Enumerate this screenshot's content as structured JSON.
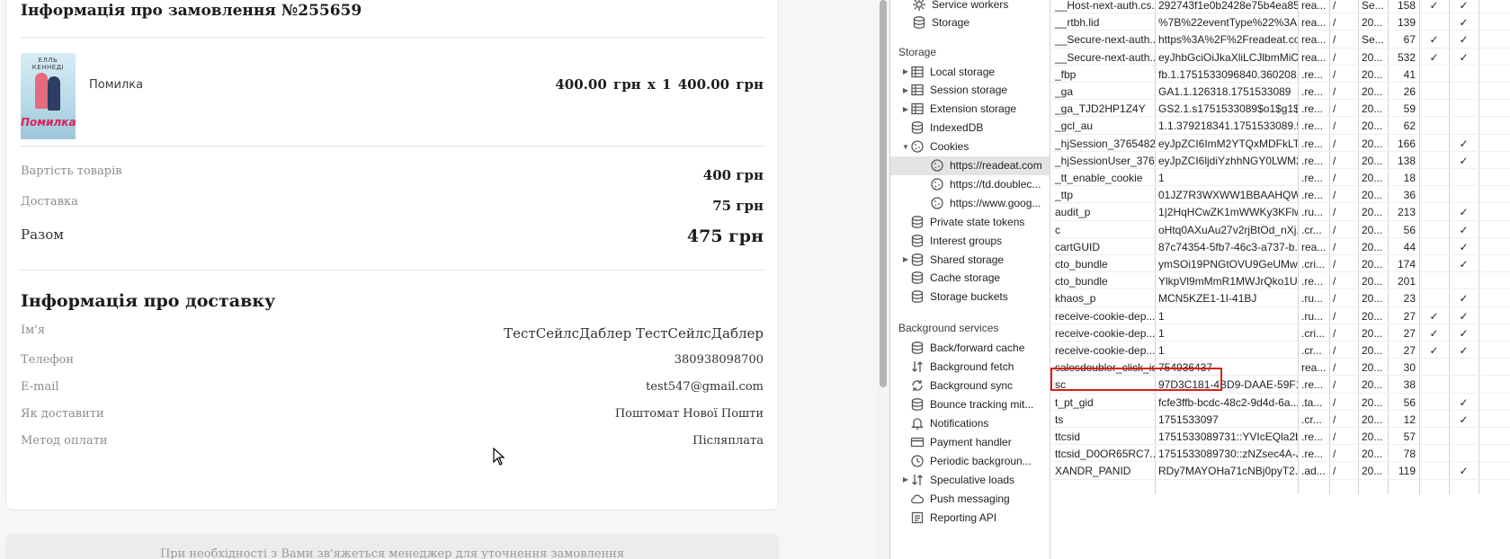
{
  "order": {
    "title": "Інформація про замовлення №255659",
    "product": {
      "cover_author": "ЕЛЛЬ КЕННЕДІ",
      "cover_title": "Помилка",
      "name": "Помилка",
      "price_line": "400.00 грн  x 1  400.00 грн"
    },
    "summary": {
      "goods_label": "Вартість товарів",
      "goods_value": "400 грн",
      "delivery_label": "Доставка",
      "delivery_value": "75 грн",
      "total_label": "Разом",
      "total_value": "475 грн"
    },
    "delivery_info": {
      "title": "Інформація про доставку",
      "name_label": "Ім'я",
      "name_value": "ТестСейлсДаблер ТестСейлсДаблер",
      "phone_label": "Телефон",
      "phone_value": "380938098700",
      "email_label": "E-mail",
      "email_value": "test547@gmail.com",
      "method_label": "Як доставити",
      "method_value": "Поштомат Нової Пошти",
      "payment_label": "Метод оплати",
      "payment_value": "Післяплата"
    },
    "manager_note": "При необхідності з Вами зв'яжеться менеджер для уточнення замовлення"
  },
  "devtools": {
    "tree_top": [
      {
        "label": "Service workers",
        "icon": "gear-icon"
      },
      {
        "label": "Storage",
        "icon": "database-icon"
      }
    ],
    "storage_header": "Storage",
    "storage_items": [
      {
        "label": "Local storage",
        "icon": "table-icon",
        "arrow": "▶"
      },
      {
        "label": "Session storage",
        "icon": "table-icon",
        "arrow": "▶"
      },
      {
        "label": "Extension storage",
        "icon": "table-icon",
        "arrow": "▶"
      },
      {
        "label": "IndexedDB",
        "icon": "database-icon",
        "arrow": ""
      },
      {
        "label": "Cookies",
        "icon": "cookie-icon",
        "arrow": "▼"
      },
      {
        "label": "https://readeat.com",
        "icon": "cookie-icon",
        "arrow": "",
        "sub": true,
        "selected": true
      },
      {
        "label": "https://td.doublec...",
        "icon": "cookie-icon",
        "arrow": "",
        "sub": true
      },
      {
        "label": "https://www.goog...",
        "icon": "cookie-icon",
        "arrow": "",
        "sub": true
      },
      {
        "label": "Private state tokens",
        "icon": "database-icon",
        "arrow": ""
      },
      {
        "label": "Interest groups",
        "icon": "database-icon",
        "arrow": ""
      },
      {
        "label": "Shared storage",
        "icon": "database-icon",
        "arrow": "▶"
      },
      {
        "label": "Cache storage",
        "icon": "database-icon",
        "arrow": ""
      },
      {
        "label": "Storage buckets",
        "icon": "database-icon",
        "arrow": ""
      }
    ],
    "background_header": "Background services",
    "background_items": [
      {
        "label": "Back/forward cache",
        "icon": "database-icon",
        "arrow": ""
      },
      {
        "label": "Background fetch",
        "icon": "fetch-icon",
        "arrow": ""
      },
      {
        "label": "Background sync",
        "icon": "sync-icon",
        "arrow": ""
      },
      {
        "label": "Bounce tracking mit...",
        "icon": "database-icon",
        "arrow": ""
      },
      {
        "label": "Notifications",
        "icon": "bell-icon",
        "arrow": ""
      },
      {
        "label": "Payment handler",
        "icon": "card-icon",
        "arrow": ""
      },
      {
        "label": "Periodic backgroun...",
        "icon": "clock-icon",
        "arrow": ""
      },
      {
        "label": "Speculative loads",
        "icon": "fetch-icon",
        "arrow": "▶"
      },
      {
        "label": "Push messaging",
        "icon": "cloud-icon",
        "arrow": ""
      },
      {
        "label": "Reporting API",
        "icon": "doc-icon",
        "arrow": ""
      }
    ],
    "cookies": [
      [
        "__Host-next-auth.cs...",
        "292743f1e0b2428e75b4ea85...",
        "rea...",
        "/",
        "Se...",
        "158",
        "✓",
        "✓"
      ],
      [
        "__rtbh.lid",
        "%7B%22eventType%22%3A...",
        "rea...",
        "/",
        "20...",
        "139",
        "",
        "✓"
      ],
      [
        "__Secure-next-auth....",
        "https%3A%2F%2Freadeat.co...",
        "rea...",
        "/",
        "Se...",
        "67",
        "✓",
        "✓"
      ],
      [
        "__Secure-next-auth....",
        "eyJhbGciOiJkaXliLCJlbmMiOi...",
        "rea...",
        "/",
        "20...",
        "532",
        "✓",
        "✓"
      ],
      [
        "_fbp",
        "fb.1.1751533096840.360208...",
        ".re...",
        "/",
        "20...",
        "41",
        "",
        ""
      ],
      [
        "_ga",
        "GA1.1.126318.1751533089",
        ".re...",
        "/",
        "20...",
        "26",
        "",
        ""
      ],
      [
        "_ga_TJD2HP1Z4Y",
        "GS2.1.s1751533089$o1$g1$t...",
        ".re...",
        "/",
        "20...",
        "59",
        "",
        ""
      ],
      [
        "_gcl_au",
        "1.1.379218341.1751533089.5...",
        ".re...",
        "/",
        "20...",
        "62",
        "",
        ""
      ],
      [
        "_hjSession_3765482",
        "eyJpZCI6ImM2YTQxMDFkLT...",
        ".re...",
        "/",
        "20...",
        "166",
        "",
        "✓"
      ],
      [
        "_hjSessionUser_376...",
        "eyJpZCI6ljdiYzhhNGY0LWM2...",
        ".re...",
        "/",
        "20...",
        "138",
        "",
        "✓"
      ],
      [
        "_tt_enable_cookie",
        "1",
        ".re...",
        "/",
        "20...",
        "18",
        "",
        ""
      ],
      [
        "_ttp",
        "01JZ7R3WXWW1BBAAHQW...",
        ".re...",
        "/",
        "20...",
        "36",
        "",
        ""
      ],
      [
        "audit_p",
        "1|2HqHCwZK1mWWKy3KFlw...",
        ".ru...",
        "/",
        "20...",
        "213",
        "",
        "✓"
      ],
      [
        "c",
        "oHtq0AXuAu27v2rjBtOd_nXj...",
        ".cr...",
        "/",
        "20...",
        "56",
        "",
        "✓"
      ],
      [
        "cartGUID",
        "87c74354-5fb7-46c3-a737-b...",
        "rea...",
        "/",
        "20...",
        "44",
        "",
        "✓"
      ],
      [
        "cto_bundle",
        "ymSOi19PNGtOVU9GeUMw...",
        ".cri...",
        "/",
        "20...",
        "174",
        "",
        "✓"
      ],
      [
        "cto_bundle",
        "YlkpVl9mMmR1MWJrQko1U...",
        ".re...",
        "/",
        "20...",
        "201",
        "",
        ""
      ],
      [
        "khaos_p",
        "MCN5KZE1-1I-41BJ",
        ".ru...",
        "/",
        "20...",
        "23",
        "",
        "✓"
      ],
      [
        "receive-cookie-dep...",
        "1",
        ".ru...",
        "/",
        "20...",
        "27",
        "✓",
        "✓"
      ],
      [
        "receive-cookie-dep...",
        "1",
        ".cri...",
        "/",
        "20...",
        "27",
        "✓",
        "✓"
      ],
      [
        "receive-cookie-dep...",
        "1",
        ".cr...",
        "/",
        "20...",
        "27",
        "✓",
        "✓"
      ],
      [
        "salesdoubler_click_id",
        "754936437",
        "rea...",
        "/",
        "20...",
        "30",
        "",
        ""
      ],
      [
        "sc",
        "97D3C181-4BD9-DAAE-59F1...",
        ".re...",
        "/",
        "20...",
        "38",
        "",
        ""
      ],
      [
        "t_pt_gid",
        "fcfe3ffb-bcdc-48c2-9d4d-6a...",
        ".ta...",
        "/",
        "20...",
        "56",
        "",
        "✓"
      ],
      [
        "ts",
        "1751533097",
        ".cr...",
        "/",
        "20...",
        "12",
        "",
        "✓"
      ],
      [
        "ttcsid",
        "1751533089731::YVIcEQla2b...",
        ".re...",
        "/",
        "20...",
        "57",
        "",
        ""
      ],
      [
        "ttcsid_D0OR65RC7...",
        "1751533089730::zNZsec4A-J...",
        ".re...",
        "/",
        "20...",
        "78",
        "",
        ""
      ],
      [
        "XANDR_PANID",
        "RDy7MAYOHa71cNBj0pyT2...",
        ".ad...",
        "/",
        "20...",
        "119",
        "",
        "✓"
      ]
    ],
    "colors": {
      "highlight": "#d62020",
      "selected_row": "#e4e4e4"
    }
  }
}
